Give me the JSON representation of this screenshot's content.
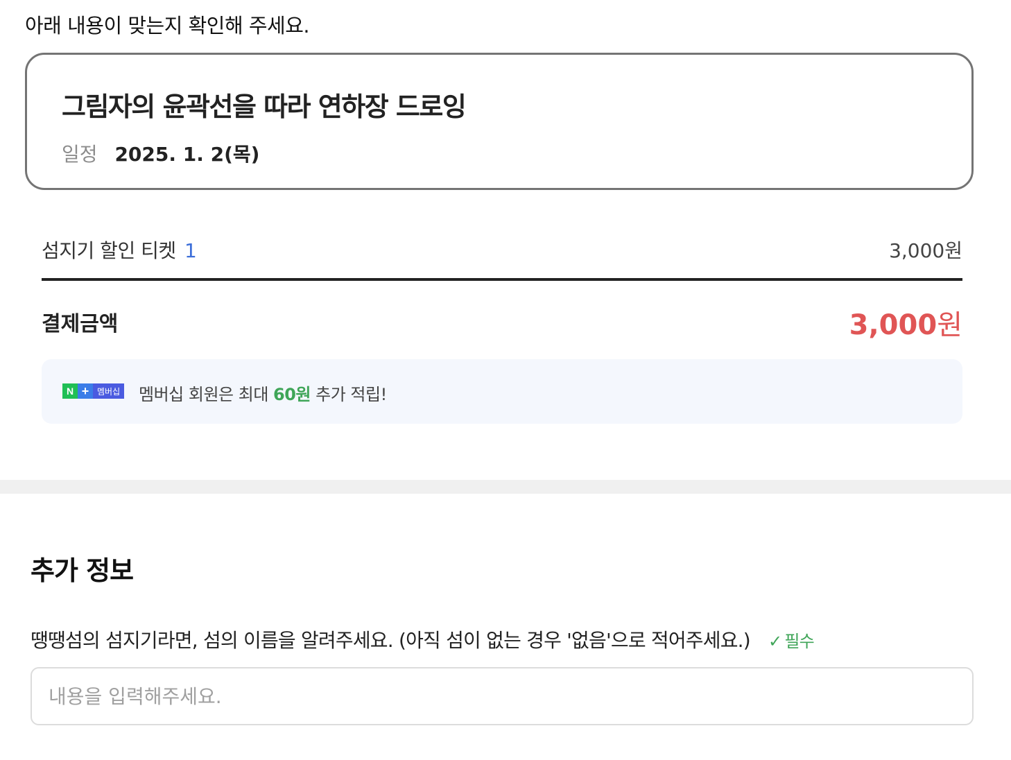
{
  "header": {
    "confirm_text": "아래 내용이 맞는지 확인해 주세요."
  },
  "event": {
    "title": "그림자의 윤곽선을 따라 연하장 드로잉",
    "schedule_label": "일정",
    "schedule_value": "2025. 1. 2(목)"
  },
  "order": {
    "ticket_name": "섬지기 할인 티켓",
    "ticket_count": "1",
    "ticket_price": "3,000원",
    "total_label": "결제금액",
    "total_amount": "3,000",
    "total_unit": "원"
  },
  "membership": {
    "badge_n": "N",
    "badge_plus": "+",
    "badge_label": "멤버십",
    "text_before": "멤버십 회원은 최대 ",
    "amount": "60원",
    "text_after": " 추가 적립!"
  },
  "additional_info": {
    "section_title": "추가 정보",
    "question": "땡땡섬의 섬지기라면, 섬의 이름을 알려주세요. (아직 섬이 없는 경우 '없음'으로 적어주세요.)",
    "required_check": "✓",
    "required_label": "필수",
    "answer_value": "",
    "answer_placeholder": "내용을 입력해주세요."
  },
  "colors": {
    "accent_green": "#3fa558",
    "price_red": "#e05555",
    "count_blue": "#3d6fd9"
  }
}
